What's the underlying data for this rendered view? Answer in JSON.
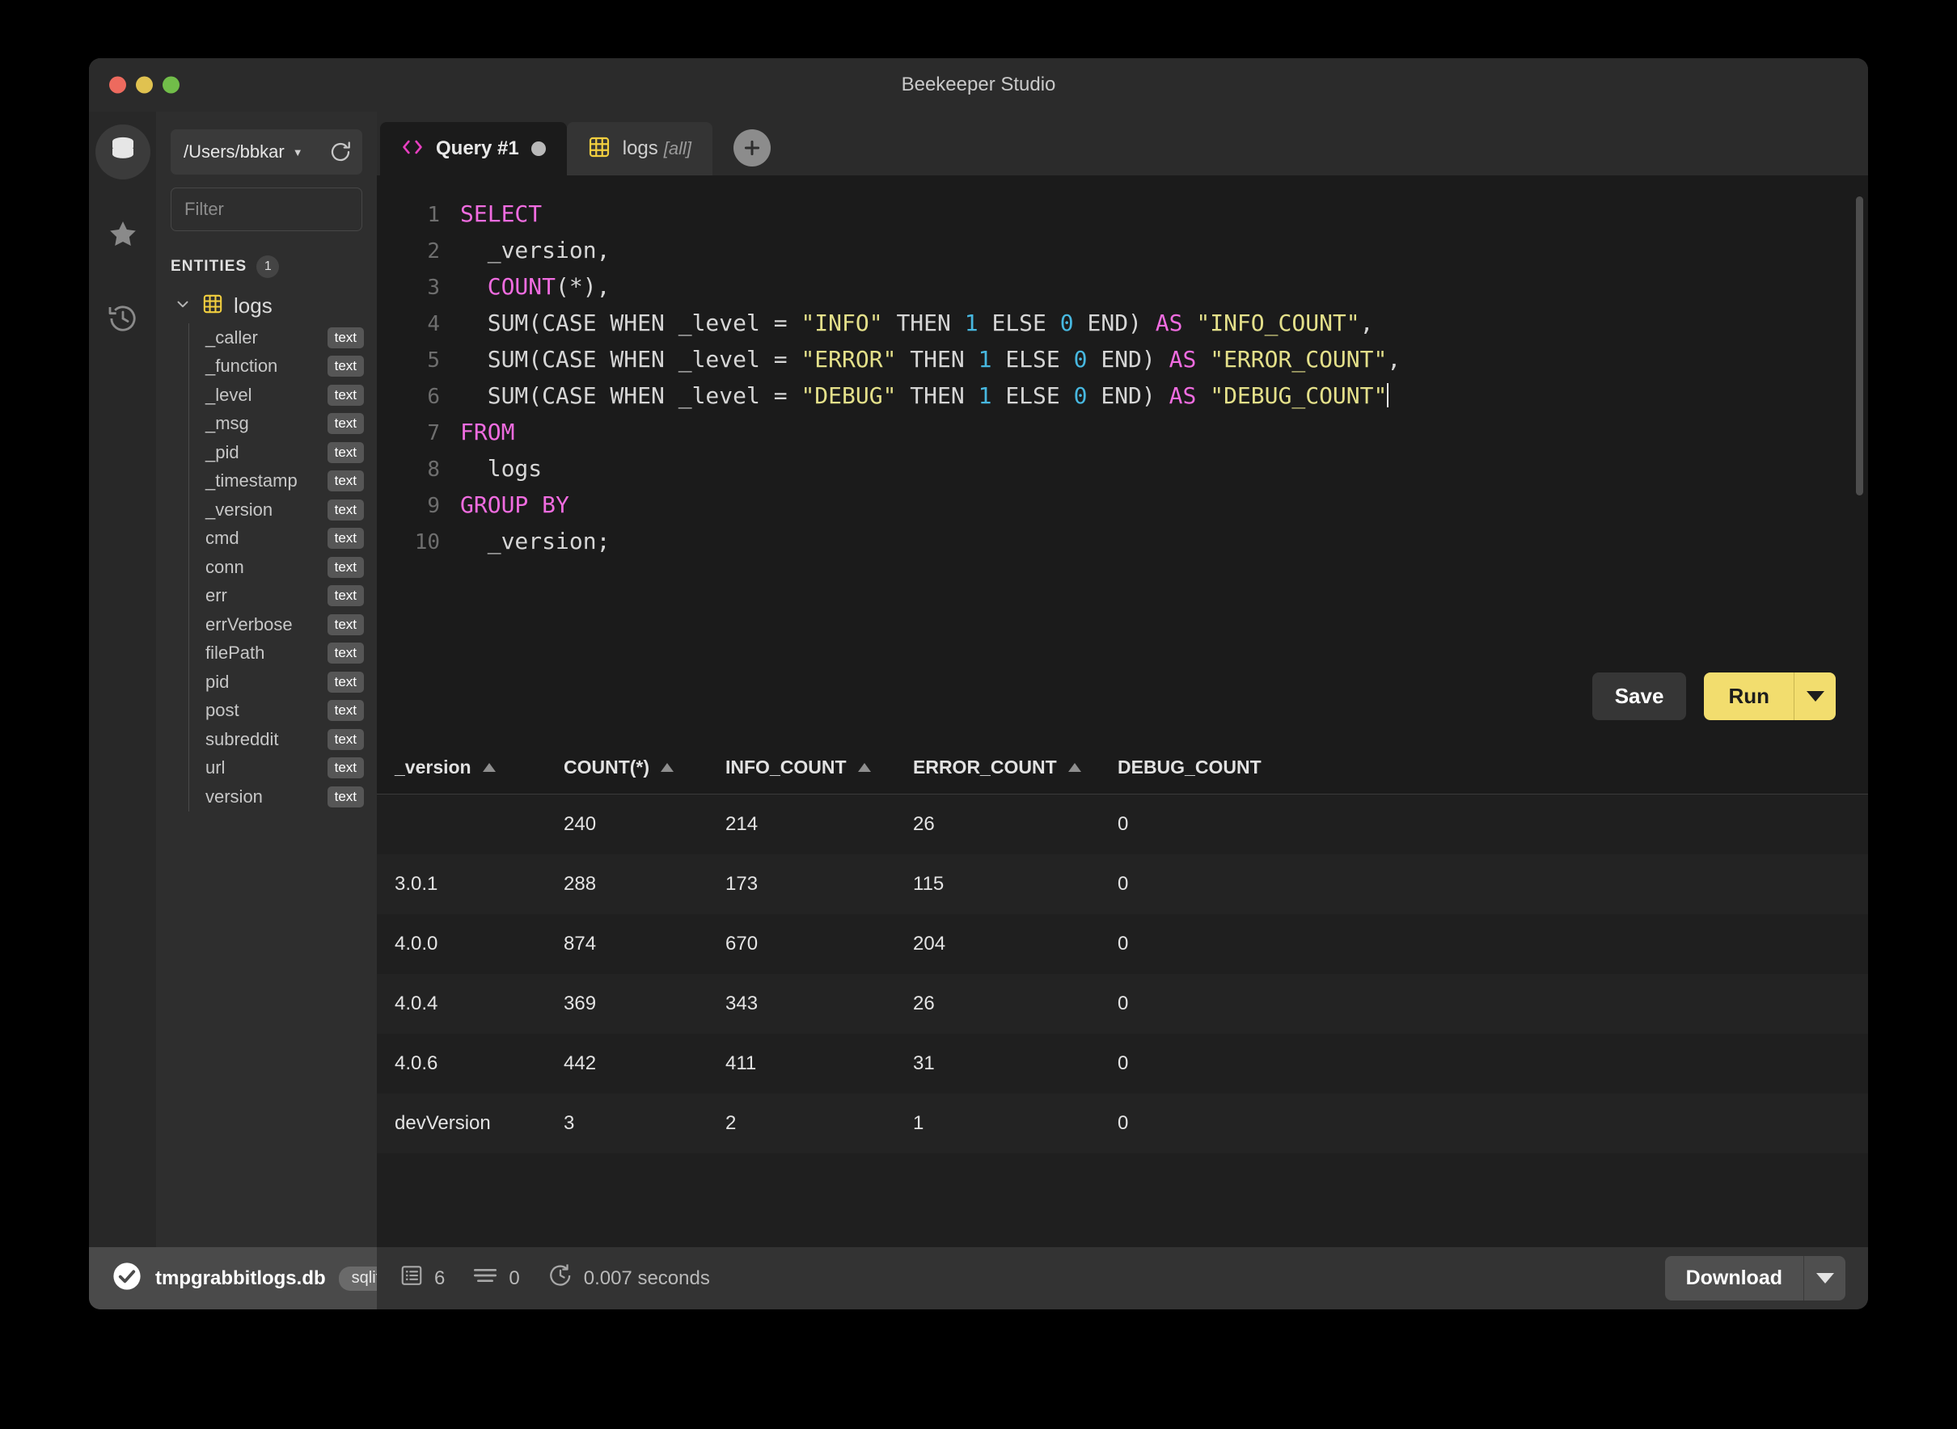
{
  "window": {
    "title": "Beekeeper Studio",
    "traffic_lights": [
      "close",
      "minimize",
      "maximize"
    ]
  },
  "rail": {
    "items": [
      {
        "name": "database-icon",
        "label": "Database"
      },
      {
        "name": "star-icon",
        "label": "Favorites"
      },
      {
        "name": "history-icon",
        "label": "History"
      }
    ]
  },
  "sidebar": {
    "connection": {
      "name": "/Users/bbkar",
      "refresh_label": "Refresh"
    },
    "filter": {
      "placeholder": "Filter",
      "value": ""
    },
    "entities": {
      "label": "ENTITIES",
      "count": "1"
    },
    "table": {
      "name": "logs",
      "expanded": true
    },
    "columns": [
      {
        "name": "_caller",
        "type": "text"
      },
      {
        "name": "_function",
        "type": "text"
      },
      {
        "name": "_level",
        "type": "text"
      },
      {
        "name": "_msg",
        "type": "text"
      },
      {
        "name": "_pid",
        "type": "text"
      },
      {
        "name": "_timestamp",
        "type": "text"
      },
      {
        "name": "_version",
        "type": "text"
      },
      {
        "name": "cmd",
        "type": "text"
      },
      {
        "name": "conn",
        "type": "text"
      },
      {
        "name": "err",
        "type": "text"
      },
      {
        "name": "errVerbose",
        "type": "text"
      },
      {
        "name": "filePath",
        "type": "text"
      },
      {
        "name": "pid",
        "type": "text"
      },
      {
        "name": "post",
        "type": "text"
      },
      {
        "name": "subreddit",
        "type": "text"
      },
      {
        "name": "url",
        "type": "text"
      },
      {
        "name": "version",
        "type": "text"
      }
    ]
  },
  "tabs": {
    "items": [
      {
        "label": "Query #1",
        "suffix": "",
        "icon": "code-icon",
        "active": true,
        "unsaved": true
      },
      {
        "label": "logs",
        "suffix": "[all]",
        "icon": "table-icon",
        "active": false,
        "unsaved": false
      }
    ],
    "add_label": "+"
  },
  "editor": {
    "lines": [
      {
        "n": "1",
        "tokens": [
          {
            "t": "SELECT",
            "c": "kw"
          }
        ]
      },
      {
        "n": "2",
        "tokens": [
          {
            "t": "  _version,",
            "c": "pl"
          }
        ]
      },
      {
        "n": "3",
        "tokens": [
          {
            "t": "  ",
            "c": "pl"
          },
          {
            "t": "COUNT",
            "c": "kw"
          },
          {
            "t": "(*),",
            "c": "pl"
          }
        ]
      },
      {
        "n": "4",
        "tokens": [
          {
            "t": "  SUM(CASE WHEN _level = ",
            "c": "pl"
          },
          {
            "t": "\"INFO\"",
            "c": "str"
          },
          {
            "t": " THEN ",
            "c": "pl"
          },
          {
            "t": "1",
            "c": "num"
          },
          {
            "t": " ELSE ",
            "c": "pl"
          },
          {
            "t": "0",
            "c": "num"
          },
          {
            "t": " END) ",
            "c": "pl"
          },
          {
            "t": "AS",
            "c": "kw"
          },
          {
            "t": " ",
            "c": "pl"
          },
          {
            "t": "\"INFO_COUNT\"",
            "c": "str"
          },
          {
            "t": ",",
            "c": "pl"
          }
        ]
      },
      {
        "n": "5",
        "tokens": [
          {
            "t": "  SUM(CASE WHEN _level = ",
            "c": "pl"
          },
          {
            "t": "\"ERROR\"",
            "c": "str"
          },
          {
            "t": " THEN ",
            "c": "pl"
          },
          {
            "t": "1",
            "c": "num"
          },
          {
            "t": " ELSE ",
            "c": "pl"
          },
          {
            "t": "0",
            "c": "num"
          },
          {
            "t": " END) ",
            "c": "pl"
          },
          {
            "t": "AS",
            "c": "kw"
          },
          {
            "t": " ",
            "c": "pl"
          },
          {
            "t": "\"ERROR_COUNT\"",
            "c": "str"
          },
          {
            "t": ",",
            "c": "pl"
          }
        ]
      },
      {
        "n": "6",
        "tokens": [
          {
            "t": "  SUM(CASE WHEN _level = ",
            "c": "pl"
          },
          {
            "t": "\"DEBUG\"",
            "c": "str"
          },
          {
            "t": " THEN ",
            "c": "pl"
          },
          {
            "t": "1",
            "c": "num"
          },
          {
            "t": " ELSE ",
            "c": "pl"
          },
          {
            "t": "0",
            "c": "num"
          },
          {
            "t": " END) ",
            "c": "pl"
          },
          {
            "t": "AS",
            "c": "kw"
          },
          {
            "t": " ",
            "c": "pl"
          },
          {
            "t": "\"DEBUG_COUNT\"",
            "c": "str"
          }
        ],
        "cursor": true
      },
      {
        "n": "7",
        "tokens": [
          {
            "t": "FROM",
            "c": "kw"
          }
        ]
      },
      {
        "n": "8",
        "tokens": [
          {
            "t": "  logs",
            "c": "pl"
          }
        ]
      },
      {
        "n": "9",
        "tokens": [
          {
            "t": "GROUP BY",
            "c": "kw"
          }
        ]
      },
      {
        "n": "10",
        "tokens": [
          {
            "t": "  _version;",
            "c": "pl"
          }
        ]
      }
    ],
    "save_label": "Save",
    "run_label": "Run"
  },
  "results": {
    "columns": [
      "_version",
      "COUNT(*)",
      "INFO_COUNT",
      "ERROR_COUNT",
      "DEBUG_COUNT"
    ],
    "sortable": [
      true,
      true,
      true,
      true,
      true
    ],
    "rows": [
      [
        "",
        "240",
        "214",
        "26",
        "0"
      ],
      [
        "3.0.1",
        "288",
        "173",
        "115",
        "0"
      ],
      [
        "4.0.0",
        "874",
        "670",
        "204",
        "0"
      ],
      [
        "4.0.4",
        "369",
        "343",
        "26",
        "0"
      ],
      [
        "4.0.6",
        "442",
        "411",
        "31",
        "0"
      ],
      [
        "devVersion",
        "3",
        "2",
        "1",
        "0"
      ]
    ]
  },
  "statusbar": {
    "db_name": "tmpgrabbitlogs.db",
    "db_engine": "sqlite",
    "row_count": "6",
    "affected_count": "0",
    "elapsed": "0.007 seconds",
    "download_label": "Download"
  },
  "colors": {
    "accent": "#f2dd6e",
    "keyword": "#f06ce0",
    "string": "#e4e08a",
    "number": "#47b8e0",
    "window_bg": "#2b2b2b",
    "editor_bg": "#1b1b1b"
  }
}
